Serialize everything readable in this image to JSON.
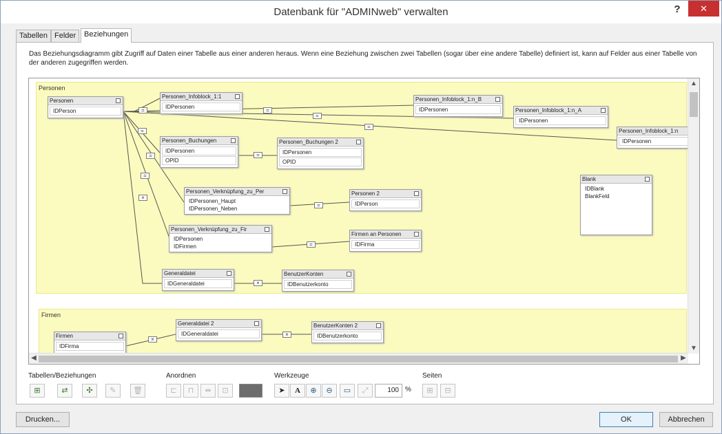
{
  "window": {
    "title": "Datenbank für \"ADMINweb\" verwalten",
    "help": "?",
    "close": "✕"
  },
  "tabs": [
    {
      "label": "Tabellen"
    },
    {
      "label": "Felder"
    },
    {
      "label": "Beziehungen"
    }
  ],
  "description": "Das Beziehungsdiagramm gibt Zugriff auf Daten einer Tabelle aus einer anderen heraus. Wenn eine Beziehung zwischen zwei Tabellen (sogar über eine andere Tabelle) definiert ist, kann auf Felder aus einer Tabelle von der anderen zugegriffen werden.",
  "areas": {
    "personen": "Personen",
    "firmen": "Firmen"
  },
  "tables": {
    "personen": {
      "name": "Personen",
      "fields": [
        "IDPerson"
      ]
    },
    "infoblock_1_1": {
      "name": "Personen_Infoblock_1:1",
      "fields": [
        "IDPersonen"
      ]
    },
    "infoblock_1n_b": {
      "name": "Personen_Infoblock_1:n_B",
      "fields": [
        "IDPersonen"
      ]
    },
    "infoblock_1n_a": {
      "name": "Personen_Infoblock_1:n_A",
      "fields": [
        "IDPersonen"
      ]
    },
    "infoblock_1n": {
      "name": "Personen_Infoblock_1:n",
      "fields": [
        "IDPersonen"
      ]
    },
    "buchungen": {
      "name": "Personen_Buchungen",
      "fields": [
        "IDPersonen",
        "OPID"
      ]
    },
    "buchungen2": {
      "name": "Personen_Buchungen 2",
      "fields": [
        "IDPersonen",
        "OPID"
      ]
    },
    "verkn_per": {
      "name": "Personen_Verknüpfung_zu_Per",
      "fields": [
        "IDPersonen_Haupt",
        "IDPersonen_Neben"
      ]
    },
    "personen2": {
      "name": "Personen 2",
      "fields": [
        "IDPerson"
      ]
    },
    "blank": {
      "name": "Blank",
      "fields": [
        "IDBlank",
        "BlankFeld"
      ]
    },
    "verkn_fir": {
      "name": "Personen_Verknüpfung_zu_Fir",
      "fields": [
        "IDPersonen",
        "IDFirmen"
      ]
    },
    "firmen_an_personen": {
      "name": "Firmen an Personen",
      "fields": [
        "IDFirma"
      ]
    },
    "generaldatei": {
      "name": "Generaldatei",
      "fields": [
        "IDGeneraldatei"
      ]
    },
    "benutzerkonten": {
      "name": "BenutzerKonten",
      "fields": [
        "IDBenutzerkonto"
      ]
    },
    "firmen": {
      "name": "Firmen",
      "fields": [
        "IDFirma"
      ]
    },
    "generaldatei2": {
      "name": "Generaldatei 2",
      "fields": [
        "IDGeneraldatei"
      ]
    },
    "benutzerkonten2": {
      "name": "BenutzerKonten 2",
      "fields": [
        "IDBenutzerkonto"
      ]
    }
  },
  "relation_symbols": {
    "equal": "=",
    "cross": "×"
  },
  "toolbar": {
    "groups": {
      "tables": "Tabellen/Beziehungen",
      "arrange": "Anordnen",
      "tools": "Werkzeuge",
      "pages": "Seiten"
    },
    "zoom_value": "100",
    "zoom_unit": "%"
  },
  "buttons": {
    "print": "Drucken...",
    "ok": "OK",
    "cancel": "Abbrechen"
  },
  "colors": {
    "area_fill": "#fbfbbf",
    "close_red": "#c7302f",
    "window_bg": "#f0f0f0"
  }
}
